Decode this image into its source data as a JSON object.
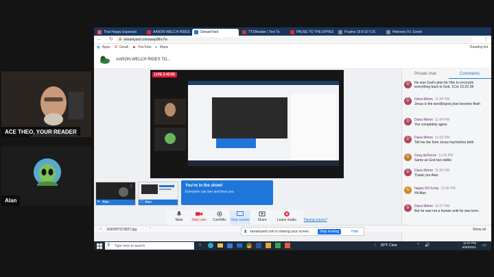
{
  "participants": [
    {
      "label": "ACE THEO, YOUR READER"
    },
    {
      "label": "Alan"
    }
  ],
  "browser": {
    "tabs": [
      "That Happy Expectati",
      "AARON WELCH RIDES",
      "StreamYard",
      "TTSReader | Text To",
      "PAUSE TO THE EPHES",
      "Psalms 19:9-10 TJS",
      "Hebrews 9:1 Greek"
    ],
    "url": "streamyard.com/aaxp8firc7w",
    "bookmarks": [
      "Apps",
      "Gmail",
      "YouTube",
      "Maps"
    ],
    "reading_list": "Reading list"
  },
  "streamyard": {
    "broadcast_title": "AARON WELCH RIDES TO...",
    "live_badge": "LIVE 2:42:55",
    "chat_tabs": [
      "Private chat",
      "Comments"
    ],
    "comments": [
      {
        "author": "",
        "time": "",
        "text": "He was God's plan for Him to reconcile everything back to God, 1Cor 15:22-28",
        "initial": "D"
      },
      {
        "author": "Dana Mimm",
        "time": "11:04 PM",
        "text": "Jesus is the word(logos) plan become flesh",
        "initial": "D"
      },
      {
        "author": "Dana Mimm",
        "time": "11:04 PM",
        "text": "Yes completely agree",
        "initial": "D"
      },
      {
        "author": "Dana Mimm",
        "time": "11:05 PM",
        "text": "Tell me the form Jesus had before birth",
        "initial": "D"
      },
      {
        "author": "Greg deFleron",
        "time": "11:06 PM",
        "text": "Same as God but visible",
        "initial": "G"
      },
      {
        "author": "Dana Mimm",
        "time": "11:06 PM",
        "text": "Thank you Alan",
        "initial": "D"
      },
      {
        "author": "happy GO lucky",
        "time": "11:06 PM",
        "text": "Hii Alan",
        "initial": "h"
      },
      {
        "author": "Dana Mimm",
        "time": "11:07 PM",
        "text": "But he was not a human until he was born.",
        "initial": "D"
      }
    ],
    "inshow_title": "You're in the show!",
    "inshow_sub": "Everyone can see and hear you",
    "thumb_names": [
      "Alan",
      "Alan"
    ],
    "controls": [
      "Mute",
      "Start cam",
      "Cam/Mic",
      "Stop screen",
      "Share",
      "Leave studio"
    ],
    "having_issues": "Having issues?",
    "sharing_notice": "streamyard.com is sharing your screen.",
    "stop_sharing": "Stop sharing",
    "hide": "Hide",
    "download_file": "1630057073827.jpg",
    "show_all": "Show all"
  },
  "taskbar": {
    "search_placeholder": "Type here to search",
    "weather": "80°F Clear",
    "time": "11:07 PM",
    "date": "8/30/2021"
  },
  "colors": {
    "tab_bar": "#17365d",
    "accent_blue": "#1f76d9",
    "live_red": "#e0203b",
    "taskbar": "#1e2a38"
  }
}
